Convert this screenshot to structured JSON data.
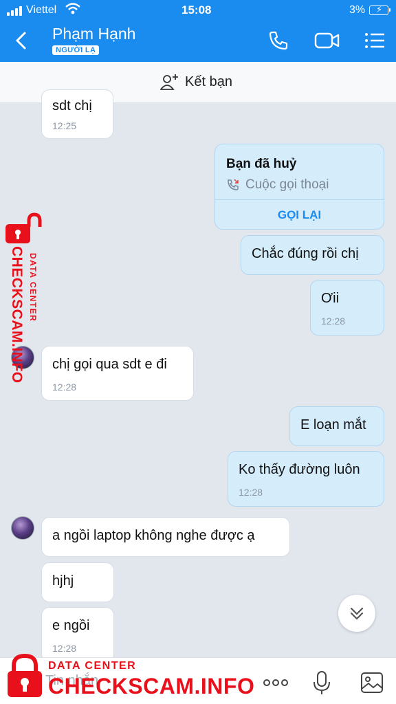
{
  "status_bar": {
    "carrier": "Viettel",
    "time": "15:08",
    "battery": "3%"
  },
  "header": {
    "contact_name": "Phạm Hạnh",
    "stranger_badge": "NGƯỜI LẠ"
  },
  "add_friend": {
    "label": "Kết bạn"
  },
  "messages": [
    {
      "side": "them",
      "text": "sdt chị",
      "time": "12:25"
    },
    {
      "side": "me",
      "type": "call",
      "title": "Bạn đã huỷ",
      "subtitle": "Cuộc gọi thoại",
      "action": "GỌI LẠI"
    },
    {
      "side": "me",
      "text": "Chắc đúng rồi chị"
    },
    {
      "side": "me",
      "text": "Ơii",
      "time": "12:28"
    },
    {
      "side": "them",
      "text": "chị gọi qua sdt e đi",
      "time": "12:28"
    },
    {
      "side": "me",
      "text": "E loạn mắt"
    },
    {
      "side": "me",
      "text": "Ko thấy đường luôn",
      "time": "12:28"
    },
    {
      "side": "them",
      "text": "a ngồi laptop không nghe được ạ"
    },
    {
      "side": "them",
      "text": "hjhj"
    },
    {
      "side": "them",
      "text": "e ngồi",
      "time": "12:28"
    }
  ],
  "input": {
    "placeholder": "Tin nhắn"
  },
  "watermark": {
    "small": "DATA CENTER",
    "big": "CHECKSCAM.INFO"
  },
  "colors": {
    "header_blue": "#1a8cf0",
    "my_bubble": "#d5ecfb",
    "their_bubble": "#ffffff",
    "chat_bg": "#e2e7ee",
    "watermark_red": "#e8101a"
  },
  "icons": [
    "back-icon",
    "phone-icon",
    "video-call-icon",
    "menu-list-icon",
    "add-friend-icon",
    "missed-call-icon",
    "chevron-double-down-icon",
    "more-icon",
    "microphone-icon",
    "image-icon",
    "lock-icon"
  ]
}
